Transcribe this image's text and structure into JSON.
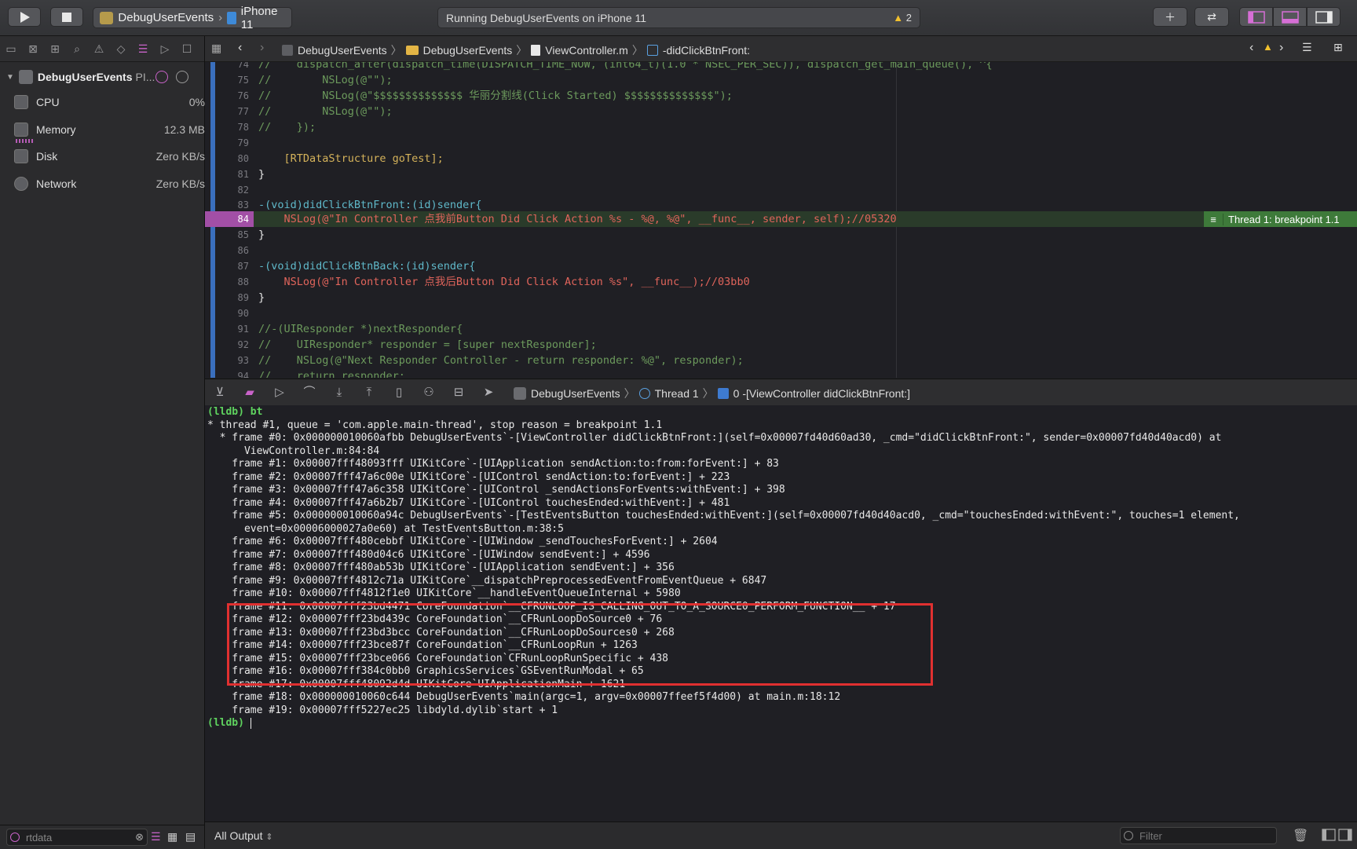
{
  "toolbar": {
    "scheme_name": "DebugUserEvents",
    "device_name": "iPhone 11",
    "activity_text": "Running DebugUserEvents on iPhone 11",
    "warning_count": "2"
  },
  "navigator": {
    "process_name": "DebugUserEvents",
    "process_suffix": "PI...",
    "gauges": [
      {
        "label": "CPU",
        "value": "0%"
      },
      {
        "label": "Memory",
        "value": "12.3 MB"
      },
      {
        "label": "Disk",
        "value": "Zero KB/s"
      },
      {
        "label": "Network",
        "value": "Zero KB/s"
      }
    ],
    "filter_value": "rtdata"
  },
  "jumpbar": {
    "crumbs": [
      "DebugUserEvents",
      "DebugUserEvents",
      "ViewController.m",
      "-didClickBtnFront:"
    ]
  },
  "editor": {
    "breakpoint_label": "Thread 1: breakpoint 1.1",
    "lines": [
      {
        "n": "74",
        "t": "//    dispatch_after(dispatch_time(DISPATCH_TIME_NOW, (int64_t)(1.0 * NSEC_PER_SEC)), dispatch_get_main_queue(), ^{"
      },
      {
        "n": "75",
        "t": "//        NSLog(@\"\");"
      },
      {
        "n": "76",
        "t": "//        NSLog(@\"$$$$$$$$$$$$$$ 华丽分割线(Click Started) $$$$$$$$$$$$$$\");"
      },
      {
        "n": "77",
        "t": "//        NSLog(@\"\");"
      },
      {
        "n": "78",
        "t": "//    });"
      },
      {
        "n": "79",
        "t": ""
      },
      {
        "n": "80",
        "t": "    [RTDataStructure goTest];"
      },
      {
        "n": "81",
        "t": "}"
      },
      {
        "n": "82",
        "t": ""
      },
      {
        "n": "83",
        "t": "-(void)didClickBtnFront:(id)sender{"
      },
      {
        "n": "84",
        "t": "    NSLog(@\"In Controller 点我前Button Did Click Action %s - %@, %@\", __func__, sender, self);//05320"
      },
      {
        "n": "85",
        "t": "}"
      },
      {
        "n": "86",
        "t": ""
      },
      {
        "n": "87",
        "t": "-(void)didClickBtnBack:(id)sender{"
      },
      {
        "n": "88",
        "t": "    NSLog(@\"In Controller 点我后Button Did Click Action %s\", __func__);//03bb0"
      },
      {
        "n": "89",
        "t": "}"
      },
      {
        "n": "90",
        "t": ""
      },
      {
        "n": "91",
        "t": "//-(UIResponder *)nextResponder{"
      },
      {
        "n": "92",
        "t": "//    UIResponder* responder = [super nextResponder];"
      },
      {
        "n": "93",
        "t": "//    NSLog(@\"Next Responder Controller - return responder: %@\", responder);"
      },
      {
        "n": "94",
        "t": "//    return responder;"
      }
    ]
  },
  "debugbar": {
    "crumbs": [
      "DebugUserEvents",
      "Thread 1",
      "0 -[ViewController didClickBtnFront:]"
    ]
  },
  "console": {
    "lines": [
      "(lldb) bt",
      "* thread #1, queue = 'com.apple.main-thread', stop reason = breakpoint 1.1",
      "  * frame #0: 0x000000010060afbb DebugUserEvents`-[ViewController didClickBtnFront:](self=0x00007fd40d60ad30, _cmd=\"didClickBtnFront:\", sender=0x00007fd40d40acd0) at",
      "      ViewController.m:84:84",
      "    frame #1: 0x00007fff48093fff UIKitCore`-[UIApplication sendAction:to:from:forEvent:] + 83",
      "    frame #2: 0x00007fff47a6c00e UIKitCore`-[UIControl sendAction:to:forEvent:] + 223",
      "    frame #3: 0x00007fff47a6c358 UIKitCore`-[UIControl _sendActionsForEvents:withEvent:] + 398",
      "    frame #4: 0x00007fff47a6b2b7 UIKitCore`-[UIControl touchesEnded:withEvent:] + 481",
      "    frame #5: 0x000000010060a94c DebugUserEvents`-[TestEventsButton touchesEnded:withEvent:](self=0x00007fd40d40acd0, _cmd=\"touchesEnded:withEvent:\", touches=1 element,",
      "      event=0x00006000027a0e60) at TestEventsButton.m:38:5",
      "    frame #6: 0x00007fff480cebbf UIKitCore`-[UIWindow _sendTouchesForEvent:] + 2604",
      "    frame #7: 0x00007fff480d04c6 UIKitCore`-[UIWindow sendEvent:] + 4596",
      "    frame #8: 0x00007fff480ab53b UIKitCore`-[UIApplication sendEvent:] + 356",
      "    frame #9: 0x00007fff4812c71a UIKitCore`__dispatchPreprocessedEventFromEventQueue + 6847",
      "    frame #10: 0x00007fff4812f1e0 UIKitCore`__handleEventQueueInternal + 5980",
      "    frame #11: 0x00007fff23bd4471 CoreFoundation`__CFRUNLOOP_IS_CALLING_OUT_TO_A_SOURCE0_PERFORM_FUNCTION__ + 17",
      "    frame #12: 0x00007fff23bd439c CoreFoundation`__CFRunLoopDoSource0 + 76",
      "    frame #13: 0x00007fff23bd3bcc CoreFoundation`__CFRunLoopDoSources0 + 268",
      "    frame #14: 0x00007fff23bce87f CoreFoundation`__CFRunLoopRun + 1263",
      "    frame #15: 0x00007fff23bce066 CoreFoundation`CFRunLoopRunSpecific + 438",
      "    frame #16: 0x00007fff384c0bb0 GraphicsServices`GSEventRunModal + 65",
      "    frame #17: 0x00007fff48092d4d UIKitCore`UIApplicationMain + 1621",
      "    frame #18: 0x000000010060c644 DebugUserEvents`main(argc=1, argv=0x00007ffeef5f4d00) at main.m:18:12",
      "    frame #19: 0x00007fff5227ec25 libdyld.dylib`start + 1",
      "(lldb) "
    ]
  },
  "bottom": {
    "output_selector": "All Output",
    "filter_placeholder": "Filter"
  }
}
